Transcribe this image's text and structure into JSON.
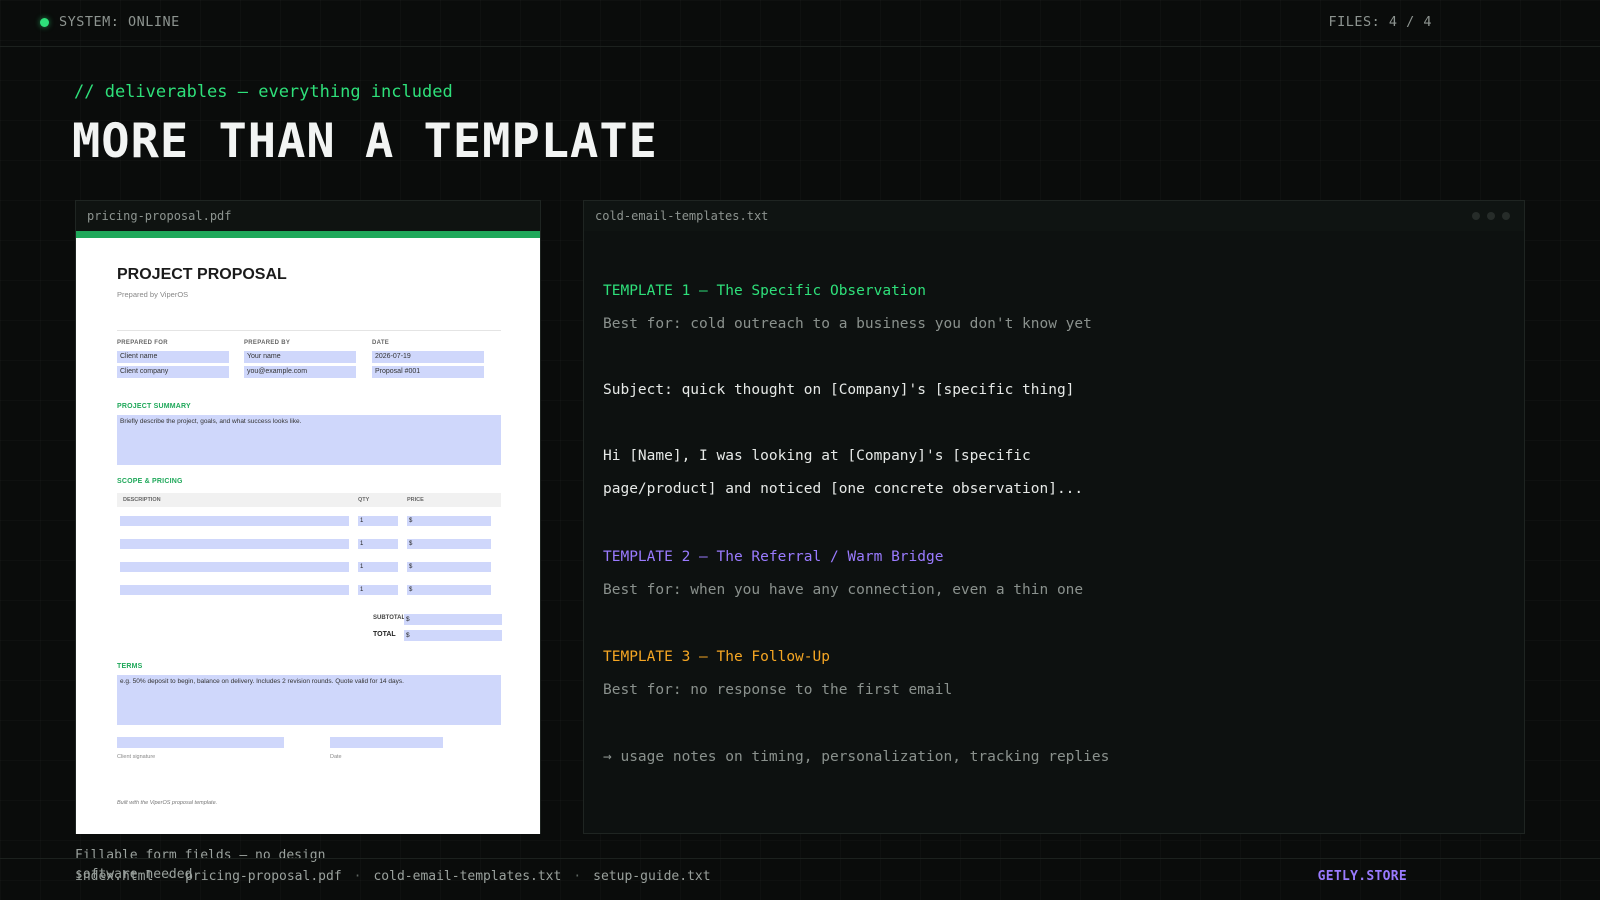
{
  "topbar": {
    "status": "SYSTEM: ONLINE",
    "files_count": "FILES: 4 / 4",
    "status_color": "#2ee07a"
  },
  "header": {
    "kicker": "// deliverables — everything included",
    "title": "MORE THAN A TEMPLATE"
  },
  "pdf_panel": {
    "filename": "pricing-proposal.pdf",
    "caption": "Fillable form fields — no design software needed",
    "doc": {
      "title": "PROJECT PROPOSAL",
      "subtitle": "Prepared by ViperOS",
      "prepared_for_label": "PREPARED FOR",
      "prepared_by_label": "PREPARED BY",
      "date_label": "DATE",
      "client_name": "Client name",
      "client_company": "Client company",
      "your_name": "Your name",
      "email": "you@example.com",
      "date": "2026-07-19",
      "proposal_no": "Proposal #001",
      "summary_label": "PROJECT SUMMARY",
      "summary_text": "Briefly describe the project, goals, and what success looks like.",
      "scope_label": "SCOPE & PRICING",
      "col_description": "DESCRIPTION",
      "col_qty": "QTY",
      "col_price": "PRICE",
      "rows": [
        {
          "qty": "1",
          "price": "$"
        },
        {
          "qty": "1",
          "price": "$"
        },
        {
          "qty": "1",
          "price": "$"
        },
        {
          "qty": "1",
          "price": "$"
        }
      ],
      "subtotal_label": "SUBTOTAL",
      "subtotal_value": "$",
      "total_label": "TOTAL",
      "total_value": "$",
      "terms_label": "TERMS",
      "terms_text": "e.g. 50% deposit to begin, balance on delivery. Includes 2 revision rounds. Quote valid for 14 days.",
      "client_signature_label": "Client signature",
      "sig_date_label": "Date",
      "footer": "Built with the ViperOS proposal template."
    }
  },
  "text_panel": {
    "filename": "cold-email-templates.txt",
    "template1_title": "TEMPLATE 1 — The Specific Observation",
    "template1_best": "Best for: cold outreach to a business you don't know yet",
    "template1_subject": "Subject: quick thought on [Company]'s [specific thing]",
    "template1_body_1": "Hi [Name], I was looking at [Company]'s [specific",
    "template1_body_2": "page/product] and noticed [one concrete observation]...",
    "template2_title": "TEMPLATE 2 — The Referral / Warm Bridge",
    "template2_best": "Best for: when you have any connection, even a thin one",
    "template3_title": "TEMPLATE 3 — The Follow-Up",
    "template3_best": "Best for: no response to the first email",
    "usage_note": "→ usage notes on timing, personalization, tracking replies"
  },
  "bottombar": {
    "files": [
      "index.html",
      "pricing-proposal.pdf",
      "cold-email-templates.txt",
      "setup-guide.txt"
    ],
    "separator": "·",
    "store": "GETLY.STORE"
  }
}
